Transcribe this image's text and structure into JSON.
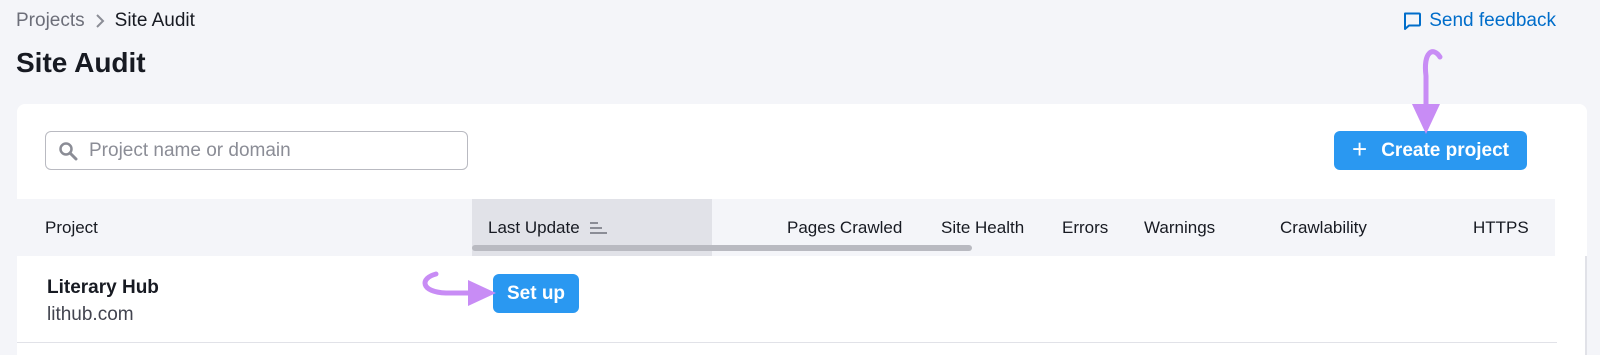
{
  "breadcrumb": {
    "projects_label": "Projects",
    "current_label": "Site Audit"
  },
  "header": {
    "title": "Site Audit",
    "feedback_label": "Send feedback",
    "feedback_icon": "message-square-icon"
  },
  "toolbar": {
    "search_placeholder": "Project name or domain",
    "search_value": "",
    "search_icon": "search-icon",
    "create_label": "Create project",
    "create_icon": "plus-icon"
  },
  "table": {
    "columns": [
      "Project",
      "Last Update",
      "Pages Crawled",
      "Site Health",
      "Errors",
      "Warnings",
      "Crawlability",
      "HTTPS"
    ],
    "sorted_column": "Last Update",
    "rows": [
      {
        "name": "Literary Hub",
        "domain": "lithub.com",
        "action_label": "Set up"
      }
    ]
  },
  "colors": {
    "accent": "#2a98f1",
    "link": "#006dca",
    "annotation": "#c88cf5",
    "background": "#f4f5f9"
  }
}
